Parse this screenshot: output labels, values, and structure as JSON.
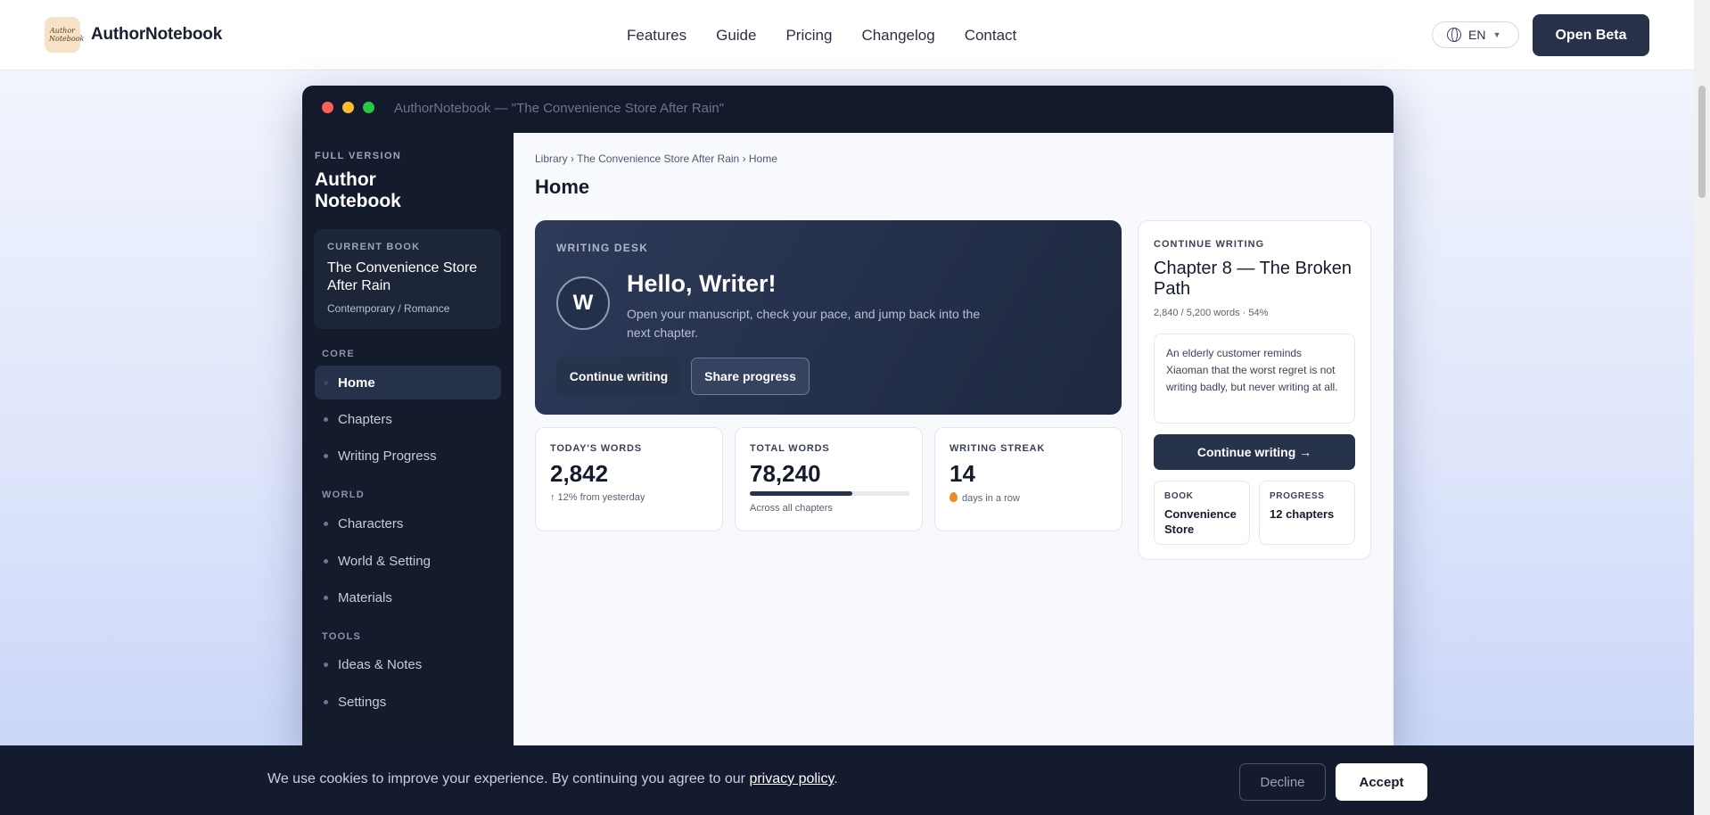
{
  "header": {
    "brand": "AuthorNotebook",
    "logo_text": "Author Notebook",
    "nav": [
      "Features",
      "Guide",
      "Pricing",
      "Changelog",
      "Contact"
    ],
    "lang": "EN",
    "cta": "Open Beta"
  },
  "window": {
    "title": "AuthorNotebook — \"The Convenience Store After Rain\""
  },
  "sidebar": {
    "version": "FULL VERSION",
    "title": "Author Notebook",
    "book_label": "CURRENT BOOK",
    "book_title": "The Convenience Store After Rain",
    "book_genre": "Contemporary / Romance",
    "sections": {
      "core": "CORE",
      "world": "WORLD",
      "tools": "TOOLS"
    },
    "items": {
      "home": "Home",
      "chapters": "Chapters",
      "progress": "Writing Progress",
      "characters": "Characters",
      "world_setting": "World & Setting",
      "materials": "Materials",
      "ideas": "Ideas & Notes",
      "settings": "Settings"
    }
  },
  "main": {
    "breadcrumb": "Library › The Convenience Store After Rain › Home",
    "title": "Home",
    "hero": {
      "label": "WRITING DESK",
      "avatar": "W",
      "greeting": "Hello, Writer!",
      "subtitle": "Open your manuscript, check your pace, and jump back into the next chapter.",
      "primary": "Continue writing",
      "secondary": "Share progress"
    },
    "stats": {
      "today": {
        "label": "TODAY'S WORDS",
        "value": "2,842",
        "sub": "↑ 12% from yesterday"
      },
      "total": {
        "label": "TOTAL WORDS",
        "value": "78,240",
        "sub": "Across all chapters",
        "progress": 0.64
      },
      "streak": {
        "label": "WRITING STREAK",
        "value": "14",
        "sub": "days in a row"
      }
    },
    "continue": {
      "label": "CONTINUE WRITING",
      "chapter": "Chapter 8 — The Broken Path",
      "meta": "2,840 / 5,200 words · 54%",
      "excerpt": "An elderly customer reminds Xiaoman that the worst regret is not writing badly, but never writing at all.",
      "button": "Continue writing →",
      "book_label": "BOOK",
      "book_value": "Convenience Store",
      "progress_label": "PROGRESS",
      "progress_value": "12 chapters"
    }
  },
  "cookie": {
    "text": "We use cookies to improve your experience. By continuing you agree to our",
    "link": "privacy policy",
    "period": ".",
    "decline": "Decline",
    "accept": "Accept"
  },
  "colors": {
    "sidebar_bg": "#141b2c",
    "accent": "#27324b",
    "titlebar": "#121a2b"
  }
}
